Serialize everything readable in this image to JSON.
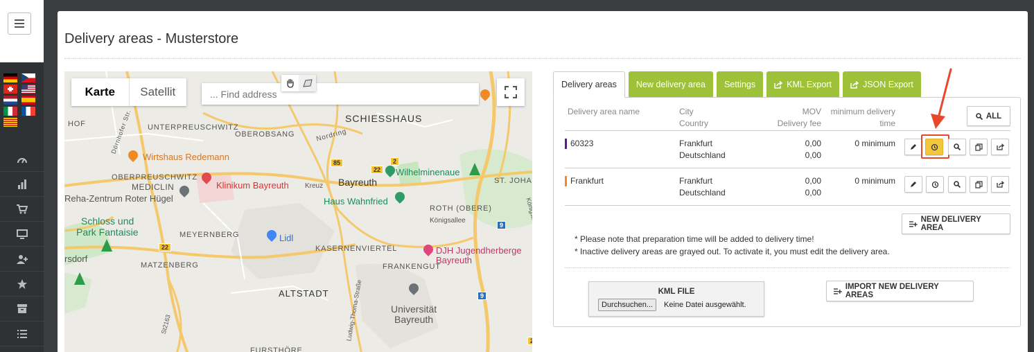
{
  "page": {
    "title": "Delivery areas - Musterstore"
  },
  "sidebar": {
    "flags": [
      "de",
      "cz",
      "ch",
      "us",
      "nl",
      "es",
      "it",
      "fr",
      "ca"
    ],
    "nav_icons": [
      "dashboard-icon",
      "bar-chart-icon",
      "cart-icon",
      "monitor-icon",
      "add-user-icon",
      "star-icon",
      "archive-icon",
      "list-icon"
    ]
  },
  "map": {
    "type_buttons": {
      "map": "Karte",
      "satellite": "Satellit"
    },
    "search_placeholder": "... Find address",
    "labels": {
      "schiesshaus": "SCHIESSHAUS",
      "unterpreuschwitz": "UNTERPREUSCHWITZ",
      "oberobsang": "OBEROBSANG",
      "nordring": "Nordring",
      "hof": "HOF",
      "doernhofer": "Dörnhofer Str.",
      "wirtshaus": "Wirtshaus Redemann",
      "klinikum": "Klinikum Bayreuth",
      "oberpreuschwitz": "OBERPREUSCHWITZ",
      "mediclin": "MEDICLIN",
      "reha": "Reha-Zentrum Roter Hügel",
      "bayreuth": "Bayreuth",
      "kreuz": "Kreuz",
      "wilhelminenaue": "Wilhelminenaue",
      "st_johann": "ST. JOHA",
      "haus_wahnfried": "Haus Wahnfried",
      "roth_obere": "ROTH (OBERE)",
      "koenigsallee": "Königsallee",
      "koenigsallee_side": "Königsallee",
      "schloss1": "Schloss und",
      "schloss2": "Park Fantaisie",
      "meyernberg": "MEYERNBERG",
      "lidl": "Lidl",
      "kasernenviertel": "KASERNENVIERTEL",
      "djh1": "DJH Jugendherberge",
      "djh2": "Bayreuth",
      "ersdorf": "rsdorf",
      "matzenberg": "MATZENBERG",
      "frankengut": "FRANKENGUT",
      "altstadt": "ALTSTADT",
      "ludwig": "Ludwig-Thoma-Straße",
      "universitaet1": "Universität",
      "universitaet2": "Bayreuth",
      "st2163": "St2163",
      "fursthoere": "FURSTHÖRE"
    },
    "shields": {
      "b85": "85",
      "b22a": "22",
      "b22b": "22",
      "b2a": "2",
      "b2b": "2",
      "a9a": "9",
      "a9b": "9"
    }
  },
  "tabs": [
    {
      "label": "Delivery areas",
      "active": true
    },
    {
      "label": "New delivery area",
      "active": false
    },
    {
      "label": "Settings",
      "active": false
    },
    {
      "label": "KML Export",
      "active": false,
      "icon": "export-icon"
    },
    {
      "label": "JSON Export",
      "active": false,
      "icon": "export-icon"
    }
  ],
  "table": {
    "headers": {
      "name": "Delivery area name",
      "city": "City",
      "country": "Country",
      "mov": "MOV",
      "fee": "Delivery fee",
      "min_time_1": "minimum delivery",
      "min_time_2": "time"
    },
    "all_button": "ALL",
    "rows": [
      {
        "name": "60323",
        "color": "#5b1a8c",
        "city": "Frankfurt",
        "country": "Deutschland",
        "mov": "0,00",
        "fee": "0,00",
        "min_time": "0 minimum"
      },
      {
        "name": "Frankfurt",
        "color": "#f08a24",
        "city": "Frankfurt",
        "country": "Deutschland",
        "mov": "0,00",
        "fee": "0,00",
        "min_time": "0 minimum"
      }
    ]
  },
  "actions": {
    "new_area": "NEW DELIVERY AREA",
    "import": "IMPORT NEW DELIVERY AREAS"
  },
  "notes": {
    "n1": "* Please note that preparation time will be added to delivery time!",
    "n2": "* Inactive delivery areas are grayed out. To activate it, you must edit the delivery area."
  },
  "kml": {
    "title": "KML FILE",
    "browse": "Durchsuchen...",
    "no_file": "Keine Datei ausgewählt."
  },
  "colors": {
    "accent_green": "#9dc23a",
    "highlight_red": "#e8472b",
    "yellow_button": "#f3c73b"
  }
}
